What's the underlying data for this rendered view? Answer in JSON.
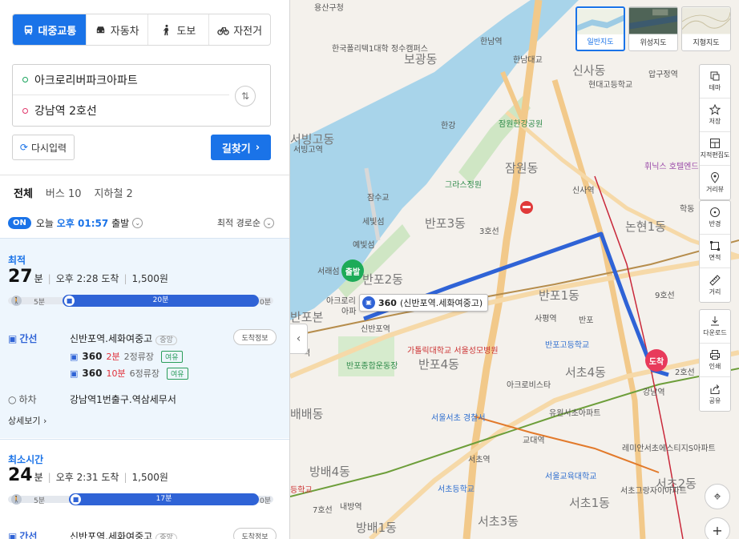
{
  "modes": {
    "transit": "대중교통",
    "car": "자동차",
    "walk": "도보",
    "bike": "자전거"
  },
  "route": {
    "from": "아크로리버파크아파트",
    "to": "강남역 2호선"
  },
  "buttons": {
    "reset": "다시입력",
    "search": "길찾기"
  },
  "result_tabs": {
    "all": "전체",
    "bus": "버스 10",
    "subway": "지하철 2"
  },
  "depart": {
    "on": "ON",
    "today": "오늘",
    "time": "오후 01:57",
    "suffix": "출발",
    "sort": "최적 경로순"
  },
  "card1": {
    "label": "최적",
    "minutes": "27",
    "min_unit": "분",
    "arrive": "오후 2:28 도착",
    "fare": "1,500원",
    "walk1": "5분",
    "bus_time": "20분",
    "walk2": "0분",
    "board_type": "간선",
    "board_stop": "신반포역.세화여중고",
    "board_tag": "중앙",
    "arrive_btn": "도착정보",
    "bus_a_num": "360",
    "bus_a_eta": "2분",
    "bus_a_stops": "2정류장",
    "bus_a_status": "여유",
    "bus_b_num": "360",
    "bus_b_eta": "10분",
    "bus_b_stops": "6정류장",
    "bus_b_status": "여유",
    "alight": "하차",
    "alight_stop": "강남역1번출구.역삼세무서",
    "detail": "상세보기"
  },
  "card2": {
    "label": "최소시간",
    "minutes": "24",
    "min_unit": "분",
    "arrive": "오후 2:31 도착",
    "fare": "1,500원",
    "walk1": "5분",
    "bus_time": "17분",
    "walk2": "0분",
    "board_type": "간선",
    "board_stop": "신반포역.세화여중고",
    "board_tag": "중앙",
    "arrive_btn": "도착정보"
  },
  "map": {
    "start_marker": "출발",
    "end_marker": "도착",
    "bus_callout_num": "360",
    "bus_callout_stop": "(신반포역.세화여중고)",
    "labels": {
      "yongsan_gu": "용산구청",
      "polytech": "한국폴리텍1대학 정수캠퍼스",
      "bogwang": "보광동",
      "hannam_station": "한남역",
      "hannam_bridge": "한남대교",
      "sinsa_dong": "신사동",
      "hyundai_hs": "현대고등학교",
      "apgujeong": "압구정역",
      "seobinggo_dong": "서빙고동",
      "seobinggo_station": "서빙고역",
      "han_river": "한강",
      "jamwon_park": "잠원한강공원",
      "jamwon_dong": "잠원동",
      "sinsa_station": "신사역",
      "hotel": "휘닉스 호텔엔드리조트",
      "gras": "그라스정원",
      "jamsu": "잠수교",
      "sebitseom": "세빛섬",
      "yebitseom": "예빛섬",
      "banpo3": "반포3동",
      "nonhyeon1": "논현1동",
      "hakdong": "학동",
      "seoraeseom": "서래섬",
      "banpo2": "반포2동",
      "acro": "아크로리",
      "apa": "아파",
      "banpobon": "반포본",
      "banpo1": "반포1동",
      "sapyeong": "사평역",
      "banpo_ic": "반포",
      "sinbanpo": "신반포역",
      "banpo_hs": "반포고등학교",
      "catholic": "가톨릭대학교 서울성모병원",
      "banpo4": "반포4동",
      "seocho4": "서초4동",
      "gangnam_station": "강남역",
      "banpo_sports": "반포종합운동장",
      "acrovista": "아크로비스타",
      "yuwon": "유원서초아파트",
      "station_b": "역",
      "baebae": "배배동",
      "seocho_police": "서울서초 경찰서",
      "gyodae": "교대역",
      "remian": "레미안서초에스티지S아파트",
      "bangbae4": "방배4동",
      "seocho_station": "서초역",
      "seoul_edu": "서울교육대학교",
      "seocho2": "서초2동",
      "seocho_grand": "서초그랑자이아파트",
      "deunghak": "등학교",
      "seocho_school": "서초등학교",
      "naebang": "내방역",
      "seocho1": "서초1동",
      "bangbae1": "방배1동",
      "seocho3": "서초3동",
      "line7": "7호선",
      "line9": "9호선",
      "line2": "2호선",
      "line3": "3호선"
    },
    "layers": {
      "normal": "일반지도",
      "satellite": "위성지도",
      "terrain": "지형지도"
    },
    "tools": {
      "theme": "테마",
      "save": "저장",
      "cadastral": "지적편집도",
      "streetview": "거리뷰",
      "radius": "반경",
      "area": "면적",
      "distance": "거리",
      "download": "다운로드",
      "print": "인쇄",
      "share": "공유"
    }
  },
  "colors": {
    "accent": "#1a73e8",
    "route": "#2f63d6",
    "start": "#1dab58",
    "end": "#e83a5b"
  }
}
